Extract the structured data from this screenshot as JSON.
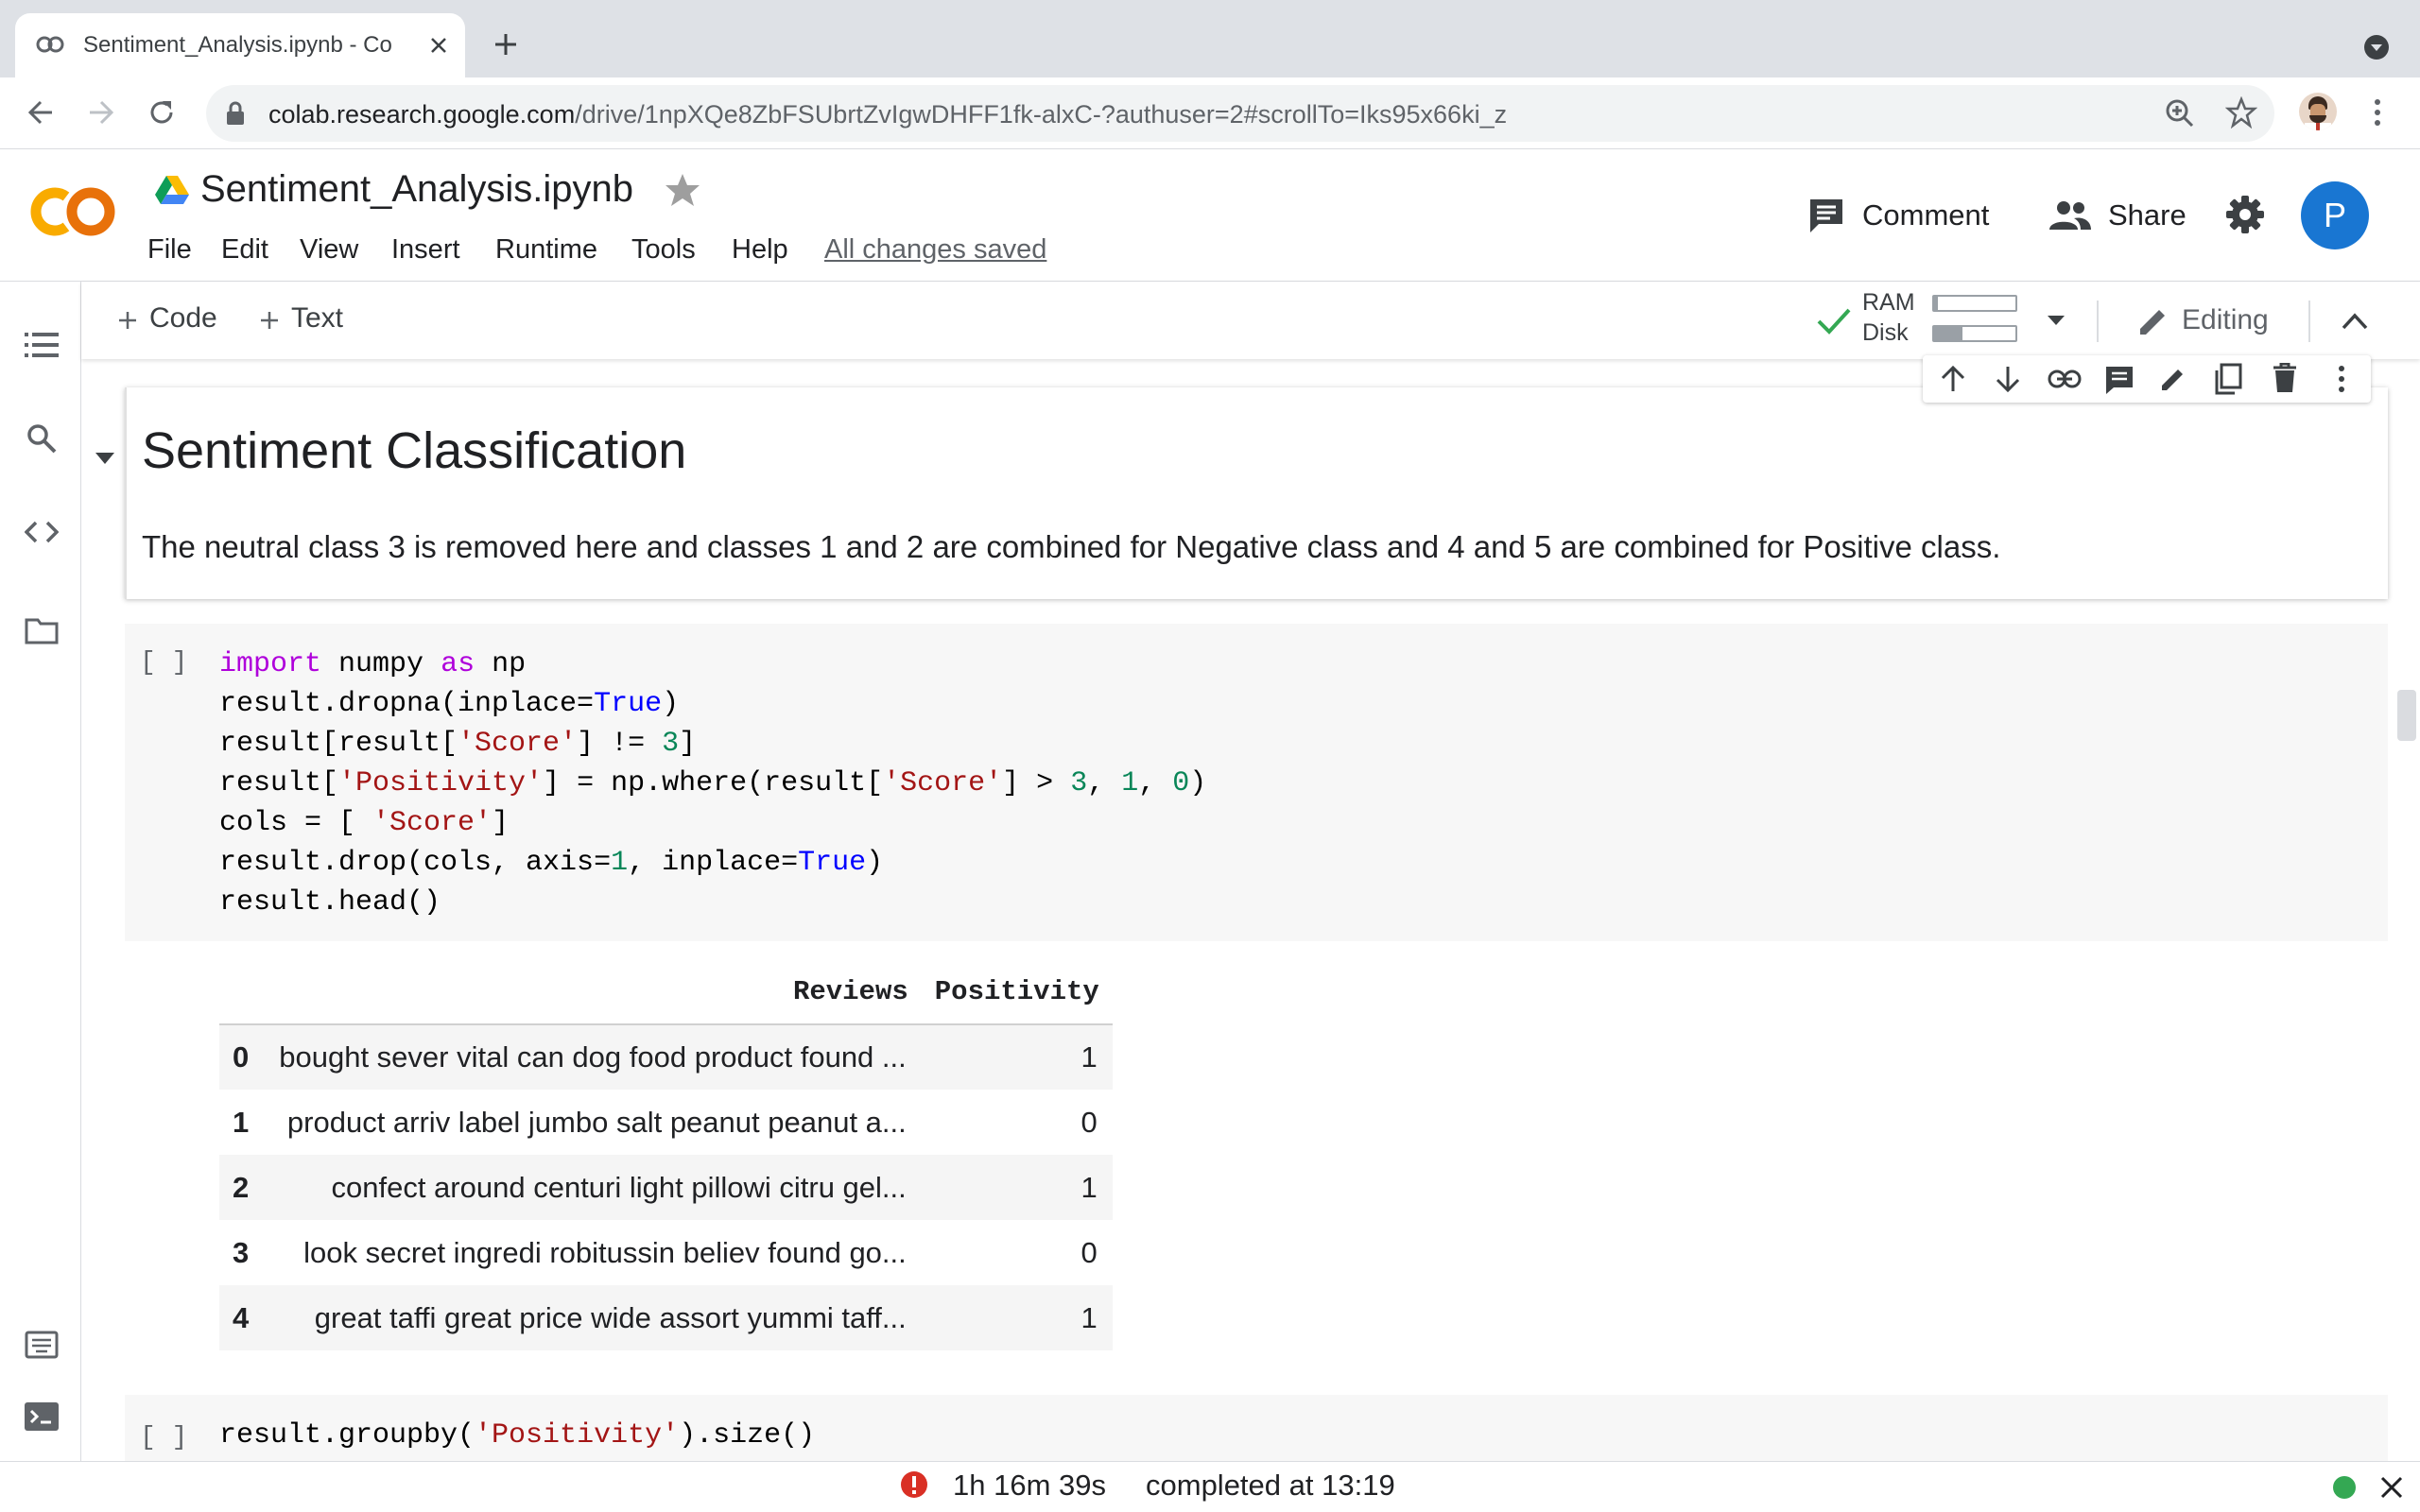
{
  "browser": {
    "tab_title": "Sentiment_Analysis.ipynb - Co",
    "url_host": "colab.research.google.com",
    "url_path": "/drive/1npXQe8ZbFSUbrtZvIgwDHFF1fk-alxC-?authuser=2#scrollTo=Iks95x66ki_z"
  },
  "colab": {
    "logo": "CO",
    "notebook_title": "Sentiment_Analysis.ipynb",
    "menu": [
      "File",
      "Edit",
      "View",
      "Insert",
      "Runtime",
      "Tools",
      "Help"
    ],
    "save_status": "All changes saved",
    "comment_label": "Comment",
    "share_label": "Share",
    "avatar_letter": "P",
    "add_code_label": "Code",
    "add_text_label": "Text",
    "ram_label": "RAM",
    "disk_label": "Disk",
    "ram_usage": 0.05,
    "disk_usage": 0.35,
    "editing_label": "Editing"
  },
  "text_cell": {
    "heading": "Sentiment Classification",
    "body": "The neutral class 3 is removed here and classes 1 and 2 are combined for Negative class and 4 and 5 are combined for Positive class."
  },
  "code_cell_1": {
    "run_bracket": "[ ]",
    "lines": [
      "import numpy as np",
      "result.dropna(inplace=True)",
      "result[result['Score'] != 3]",
      "result['Positivity'] = np.where(result['Score'] > 3, 1, 0)",
      "cols = [ 'Score']",
      "result.drop(cols, axis=1, inplace=True)",
      "result.head()"
    ]
  },
  "dataframe": {
    "columns": [
      "",
      "Reviews",
      "Positivity"
    ],
    "rows": [
      [
        "0",
        "bought sever vital can dog food product found ...",
        "1"
      ],
      [
        "1",
        "product arriv label jumbo salt peanut peanut a...",
        "0"
      ],
      [
        "2",
        "confect around centuri light pillowi citru gel...",
        "1"
      ],
      [
        "3",
        "look secret ingredi robitussin believ found go...",
        "0"
      ],
      [
        "4",
        "great taffi great price wide assort yummi taff...",
        "1"
      ]
    ]
  },
  "code_cell_2": {
    "run_bracket": "[ ]",
    "line": "result.groupby('Positivity').size()"
  },
  "status": {
    "elapsed": "1h 16m 39s",
    "completed": "completed at 13:19"
  }
}
